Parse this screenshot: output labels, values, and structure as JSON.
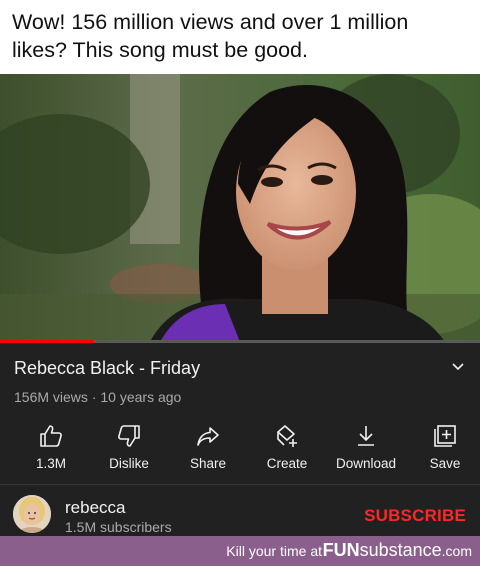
{
  "caption": {
    "line1": "Wow! 156 million views and over 1 million",
    "line2": "likes? This song must be good."
  },
  "video": {
    "progress_fraction": 0.195
  },
  "details": {
    "title": "Rebecca Black - Friday",
    "views": "156M views",
    "separator": "·",
    "age": "10 years ago"
  },
  "actions": [
    {
      "label": "1.3M",
      "icon": "thumbs-up-icon"
    },
    {
      "label": "Dislike",
      "icon": "thumbs-down-icon"
    },
    {
      "label": "Share",
      "icon": "share-arrow-icon"
    },
    {
      "label": "Create",
      "icon": "create-remix-icon"
    },
    {
      "label": "Download",
      "icon": "download-icon"
    },
    {
      "label": "Save",
      "icon": "save-playlist-icon"
    }
  ],
  "channel": {
    "name": "rebecca",
    "subscribers": "1.5M subscribers",
    "subscribe_label": "SUBSCRIBE"
  },
  "footer": {
    "tagline": "Kill your time at",
    "brand_bold": "FUN",
    "brand_rest": "substance",
    "brand_suffix": ".com"
  },
  "colors": {
    "panel_bg": "#212121",
    "subscribe_red": "#ff2626",
    "progress_red": "#ff0000",
    "footer_purple": "#8a5f8b"
  }
}
